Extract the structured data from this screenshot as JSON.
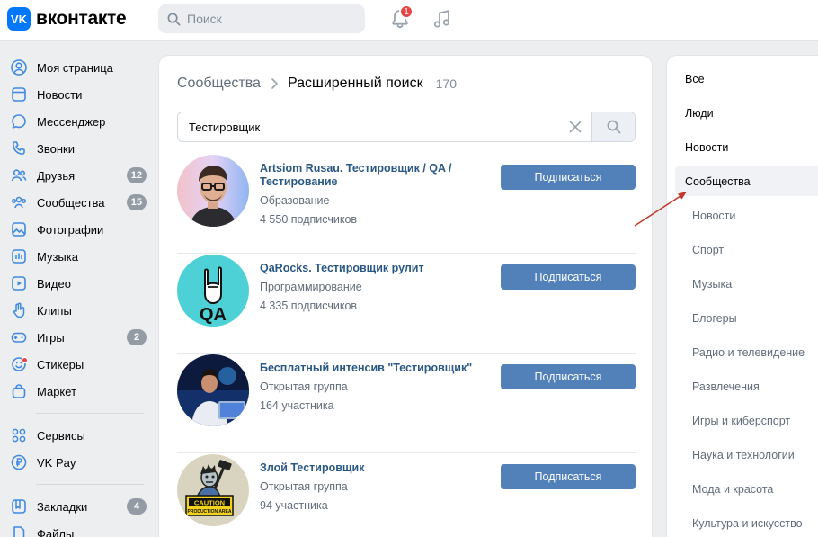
{
  "header": {
    "logo_mark": "VK",
    "logo_text": "вконтакте",
    "search_placeholder": "Поиск",
    "notifications_count": "1"
  },
  "sidebar": {
    "items": [
      {
        "label": "Моя страница",
        "icon": "user-circle-icon"
      },
      {
        "label": "Новости",
        "icon": "newspaper-icon"
      },
      {
        "label": "Мессенджер",
        "icon": "message-icon"
      },
      {
        "label": "Звонки",
        "icon": "phone-icon"
      },
      {
        "label": "Друзья",
        "icon": "friends-icon",
        "count": "12"
      },
      {
        "label": "Сообщества",
        "icon": "communities-icon",
        "count": "15"
      },
      {
        "label": "Фотографии",
        "icon": "photo-icon"
      },
      {
        "label": "Музыка",
        "icon": "music-icon"
      },
      {
        "label": "Видео",
        "icon": "video-icon"
      },
      {
        "label": "Клипы",
        "icon": "clips-icon"
      },
      {
        "label": "Игры",
        "icon": "gamepad-icon",
        "count": "2"
      },
      {
        "label": "Стикеры",
        "icon": "sticker-icon"
      },
      {
        "label": "Маркет",
        "icon": "market-icon"
      },
      {
        "label": "Сервисы",
        "icon": "services-icon"
      },
      {
        "label": "VK Pay",
        "icon": "vkpay-icon"
      },
      {
        "label": "Закладки",
        "icon": "bookmark-icon",
        "count": "4"
      },
      {
        "label": "Файлы",
        "icon": "file-icon"
      }
    ]
  },
  "main": {
    "breadcrumb_root": "Сообщества",
    "breadcrumb_current": "Расширенный поиск",
    "result_count": "170",
    "query": "Тестировщик",
    "subscribe_label": "Подписаться",
    "results": [
      {
        "title": "Artsiom Rusau. Тестировщик / QA / Тестирование",
        "category": "Образование",
        "members": "4 550 подписчиков"
      },
      {
        "title": "QaRocks. Тестировщик рулит",
        "category": "Программирование",
        "members": "4 335 подписчиков",
        "avatar_text": "QA"
      },
      {
        "title": "Бесплатный интенсив \"Тестировщик\"",
        "category": "Открытая группа",
        "members": "164 участника"
      },
      {
        "title": "Злой Тестировщик",
        "category": "Открытая группа",
        "members": "94 участника",
        "avatar_text_1": "CAUTION",
        "avatar_text_2": "PRODUCTION AREA"
      }
    ]
  },
  "filters": {
    "top": [
      "Все",
      "Люди",
      "Новости",
      "Сообщества"
    ],
    "sub": [
      "Новости",
      "Спорт",
      "Музыка",
      "Блогеры",
      "Радио и телевидение",
      "Развлечения",
      "Игры и киберспорт",
      "Наука и технологии",
      "Мода и красота",
      "Культура и искусство"
    ]
  },
  "colors": {
    "brand": "#0077ff",
    "link": "#2a5885",
    "button": "#5181b8",
    "badge": "#e64646",
    "annotation_arrow": "#c0392b"
  }
}
